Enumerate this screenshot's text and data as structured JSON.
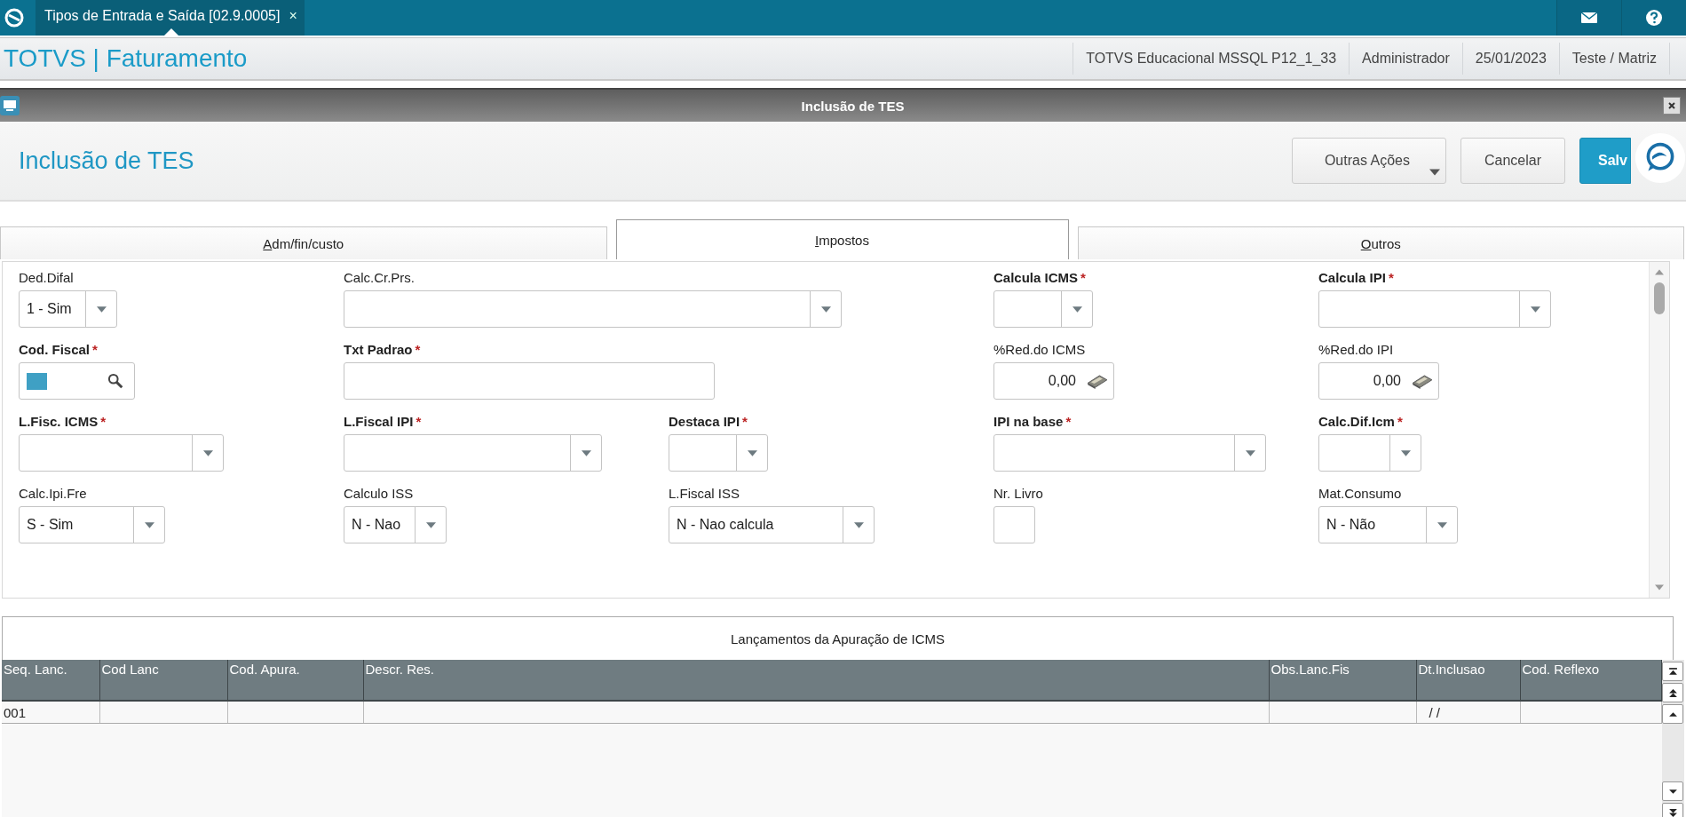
{
  "top_bar": {
    "tab": {
      "title": "Tipos de Entrada e Saída [02.9.0005]",
      "close": "×",
      "selected": true
    }
  },
  "app_header": {
    "title": "TOTVS | Faturamento",
    "info": [
      "TOTVS Educacional MSSQL P12_1_33",
      "Administrador",
      "25/01/2023",
      "Teste / Matriz"
    ]
  },
  "dialog": {
    "title": "Inclusão de TES",
    "heading": "Inclusão de TES",
    "buttons": [
      {
        "label": "Outras Ações",
        "kind": "menu"
      },
      {
        "label": "Cancelar",
        "kind": "plain"
      },
      {
        "label": "Salv",
        "kind": "primary"
      }
    ],
    "tabs": [
      {
        "label": "Adm/fin/custo",
        "selected": false
      },
      {
        "label": "Impostos",
        "selected": true
      },
      {
        "label": "Outros",
        "selected": false
      }
    ],
    "form_rows": [
      [
        {
          "label": "Ded.Difal",
          "required": false,
          "kind": "select",
          "value": "1 - Sim"
        },
        {
          "label": "Calc.Cr.Prs.",
          "required": false,
          "kind": "select"
        },
        {
          "label": "Calcula ICMS",
          "required": true,
          "mark": "*",
          "kind": "select"
        },
        {
          "label": "Calcula IPI",
          "required": true,
          "mark": "*",
          "kind": "select"
        }
      ],
      [
        {
          "label": "Cod. Fiscal",
          "required": true,
          "mark": "*",
          "kind": "lookup"
        },
        {
          "label": "Txt Padrao",
          "required": true,
          "mark": "*",
          "kind": "text"
        },
        {
          "label": "%Red.do ICMS",
          "required": false,
          "kind": "number",
          "value": "0,00"
        },
        {
          "label": "%Red.do IPI",
          "required": false,
          "kind": "number",
          "value": "0,00"
        }
      ],
      [
        {
          "label": "L.Fisc. ICMS",
          "required": true,
          "mark": "*",
          "kind": "select"
        },
        {
          "label": "L.Fiscal IPI",
          "required": true,
          "mark": "*",
          "kind": "select"
        },
        {
          "label": "Destaca IPI",
          "required": true,
          "mark": "*",
          "kind": "select"
        },
        {
          "label": "IPI na base",
          "required": true,
          "mark": "*",
          "kind": "select"
        },
        {
          "label": "Calc.Dif.Icm",
          "required": true,
          "mark": "*",
          "kind": "select"
        }
      ],
      [
        {
          "label": "Calc.Ipi.Fre",
          "required": false,
          "kind": "select",
          "value": "S - Sim"
        },
        {
          "label": "Calculo ISS",
          "required": false,
          "kind": "select",
          "value": "N - Nao"
        },
        {
          "label": "L.Fiscal ISS",
          "required": false,
          "kind": "select",
          "value": "N - Nao calcula"
        },
        {
          "label": "Nr. Livro",
          "required": false,
          "kind": "text"
        },
        {
          "label": "Mat.Consumo",
          "required": false,
          "kind": "select",
          "value": "N - Não"
        }
      ]
    ],
    "grid": {
      "title": "Lançamentos da Apuração de ICMS",
      "columns": [
        "Seq. Lanc.",
        "Cod Lanc",
        "Cod. Apura.",
        "Descr. Res.",
        "Obs.Lanc.Fis",
        "Dt.Inclusao",
        "Cod. Reflexo"
      ],
      "rows": [
        [
          "001",
          "",
          "",
          "",
          "",
          "/ /",
          ""
        ]
      ]
    }
  }
}
